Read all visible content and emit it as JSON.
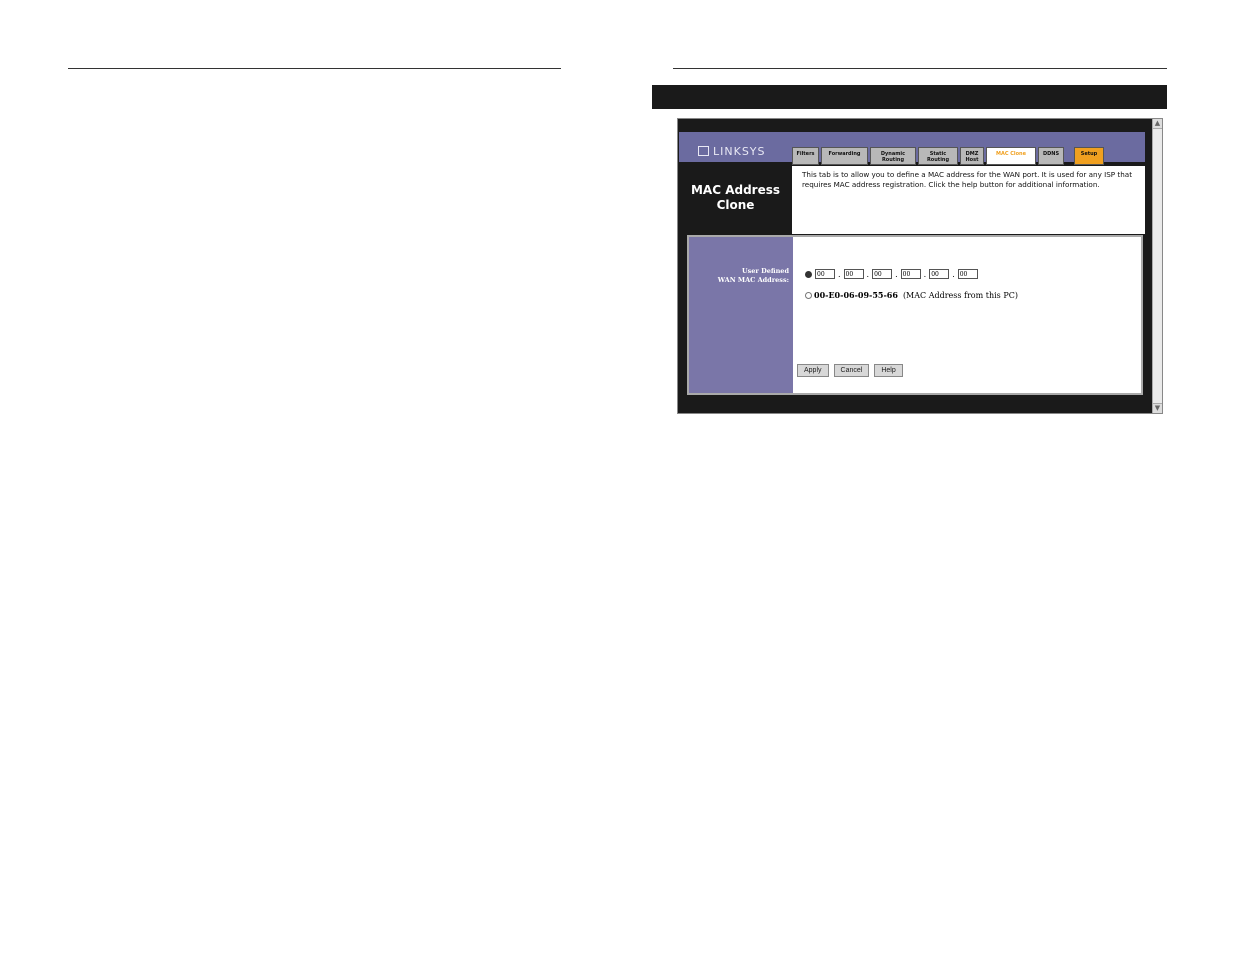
{
  "logo": {
    "text": "LINKSYS"
  },
  "tabs": [
    {
      "label": "Filters"
    },
    {
      "label": "Forwarding"
    },
    {
      "label": "Dynamic Routing"
    },
    {
      "label": "Static Routing"
    },
    {
      "label": "DMZ Host"
    },
    {
      "label": "MAC Clone",
      "active": true
    },
    {
      "label": "DDNS"
    },
    {
      "label": "Setup"
    }
  ],
  "page": {
    "title_line1": "MAC Address",
    "title_line2": "Clone",
    "description": "This tab is to allow you to define a MAC address for the WAN port. It is used for any ISP that requires MAC address registration. Click the help button for additional information."
  },
  "form": {
    "side_label_line1": "User Defined",
    "side_label_line2": "WAN MAC Address:",
    "mac_fields": [
      "00",
      "00",
      "00",
      "00",
      "00",
      "00"
    ],
    "pc_mac": "00-E0-06-09-55-66",
    "pc_mac_note": "(MAC Address from this PC)"
  },
  "buttons": {
    "apply": "Apply",
    "cancel": "Cancel",
    "help": "Help"
  },
  "colors": {
    "band": "#6b6ba0",
    "side_panel": "#7a76a8",
    "active_tab": "#f0a020"
  }
}
